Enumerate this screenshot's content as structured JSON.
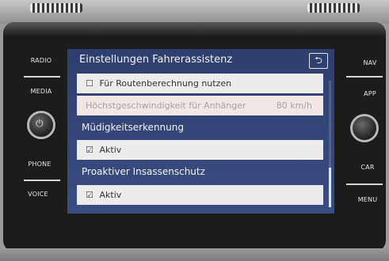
{
  "hardware": {
    "left_buttons": [
      "RADIO",
      "MEDIA",
      "PHONE",
      "VOICE"
    ],
    "right_buttons": [
      "NAV",
      "APP",
      "CAR",
      "MENU"
    ]
  },
  "header": {
    "title": "Einstellungen Fahrerassistenz",
    "back_icon": "back-arrow-icon"
  },
  "rows": {
    "route": {
      "checkbox": "☐",
      "label": "Für Routenberechnung nutzen"
    },
    "trailer": {
      "label": "Höchstgeschwindigkeit für Anhänger",
      "value": "80 km/h"
    }
  },
  "sections": {
    "fatigue": {
      "title": "Müdigkeitserkennung",
      "checkbox": "☑",
      "label": "Aktiv"
    },
    "occupant": {
      "title": "Proaktiver Insassenschutz",
      "checkbox": "☑",
      "label": "Aktiv"
    }
  }
}
